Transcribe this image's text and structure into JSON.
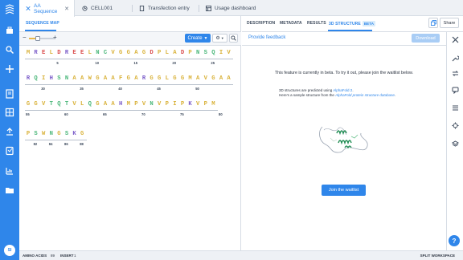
{
  "tabs": [
    {
      "label": "AA Sequence",
      "active": true,
      "closable": true,
      "icon": "dna-icon"
    },
    {
      "label": "CELL001",
      "active": false,
      "icon": "clock-icon"
    },
    {
      "label": "Transfection entry",
      "active": false,
      "icon": "document-icon"
    },
    {
      "label": "Usage dashboard",
      "active": false,
      "icon": "dashboard-icon"
    }
  ],
  "left": {
    "subtab": "SEQUENCE MAP",
    "create_label": "Create",
    "zoom_level": 0.35,
    "sequence": [
      {
        "residues": [
          "M",
          "R",
          "E",
          "L",
          "D",
          "R",
          "E",
          "E",
          "L",
          "N",
          "C",
          "V",
          "G",
          "G",
          "A",
          "G",
          "D",
          "P",
          "L",
          "A",
          "D",
          "P",
          "N",
          "S",
          "Q",
          "I",
          "V"
        ],
        "ticks": [
          "5",
          "10",
          "15",
          "20",
          "25"
        ]
      },
      {
        "residues": [
          "R",
          "Q",
          "I",
          "H",
          "S",
          "N",
          "A",
          "A",
          "W",
          "G",
          "A",
          "A",
          "F",
          "G",
          "A",
          "R",
          "G",
          "G",
          "L",
          "G",
          "G",
          "M",
          "A",
          "V",
          "G",
          "A",
          "A"
        ],
        "ticks": [
          "30",
          "35",
          "40",
          "45",
          "50"
        ]
      },
      {
        "residues": [
          "G",
          "G",
          "V",
          "T",
          "Q",
          "T",
          "V",
          "L",
          "Q",
          "G",
          "A",
          "A",
          "H",
          "M",
          "P",
          "V",
          "N",
          "V",
          "P",
          "I",
          "P",
          "K",
          "V",
          "P",
          "M"
        ],
        "ticks": [
          "55",
          "60",
          "65",
          "70",
          "75",
          "80"
        ]
      },
      {
        "residues": [
          "P",
          "S",
          "W",
          "N",
          "G",
          "S",
          "K",
          "G"
        ],
        "ticks": [
          "82",
          "84",
          "86",
          "88"
        ]
      }
    ]
  },
  "right": {
    "subtabs": [
      "DESCRIPTION",
      "METADATA",
      "RESULTS",
      "3D STRUCTURE"
    ],
    "beta_badge": "BETA",
    "provide_feedback": "Provide feedback",
    "download": "Download",
    "beta_msg": "This feature is currently in beta. To try it out, please join the waitlist below.",
    "predicted_prefix": "3D structures are predicted using ",
    "predicted_link": "AlphaFold 2",
    "predicted_suffix": ".",
    "sample_prefix": "Here's a sample structure from the ",
    "sample_link": "AlphaFold protein structure database",
    "sample_suffix": ".",
    "join_waitlist": "Join the waitlist"
  },
  "header_right": {
    "share": "Share"
  },
  "status": {
    "aa_label": "AMINO ACIDS",
    "aa_value": "89",
    "insert_label": "INSERT",
    "insert_value": "1",
    "split": "SPLIT WORKSPACE"
  },
  "user_initials": "SI",
  "colors": {
    "accent": "#2f86ea",
    "rail": "#2f86ea"
  }
}
